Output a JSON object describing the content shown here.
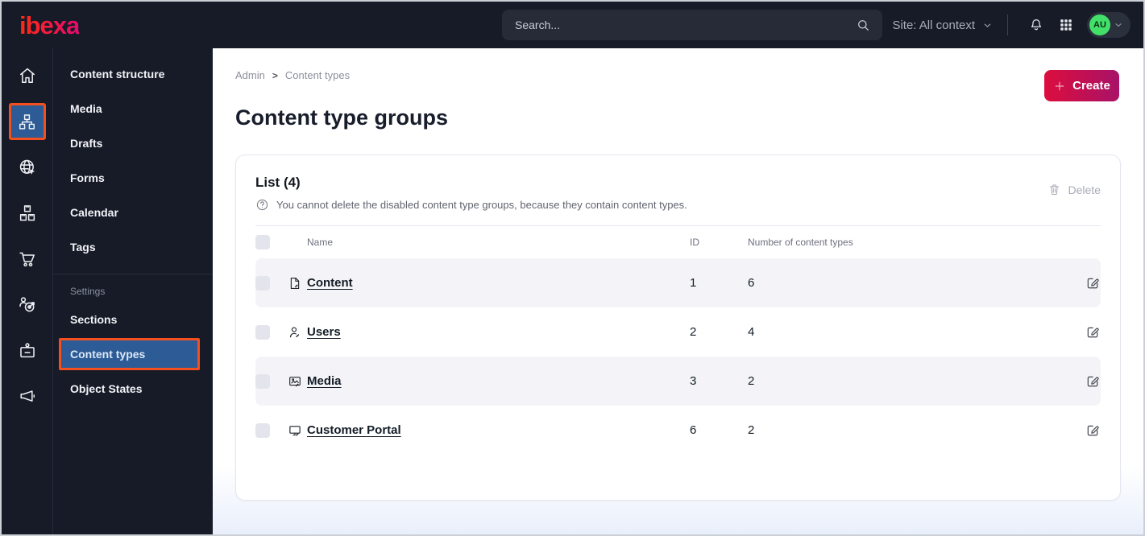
{
  "colors": {
    "topbar-bg": "#161b27",
    "accent-orange": "#f4501f",
    "active-blue": "#2c5b95",
    "create-grad-start": "#dc0e3e",
    "create-grad-end": "#a81267",
    "avatar-green": "#43e069",
    "link-dark": "#131c26"
  },
  "topbar": {
    "logo_text": "ibexa",
    "search": {
      "placeholder": "Search..."
    },
    "site_selector": {
      "label": "Site: All context"
    },
    "avatar": {
      "initials": "AU"
    }
  },
  "rail": {
    "items": [
      {
        "name": "dashboard"
      },
      {
        "name": "content",
        "active": true
      },
      {
        "name": "site"
      },
      {
        "name": "product-catalog"
      },
      {
        "name": "commerce"
      },
      {
        "name": "personalization"
      },
      {
        "name": "admin"
      },
      {
        "name": "campaign"
      }
    ]
  },
  "sidebar": {
    "items": [
      {
        "label": "Content structure"
      },
      {
        "label": "Media"
      },
      {
        "label": "Drafts"
      },
      {
        "label": "Forms"
      },
      {
        "label": "Calendar"
      },
      {
        "label": "Tags"
      }
    ],
    "settings_section": {
      "label": "Settings",
      "items": [
        {
          "label": "Sections"
        },
        {
          "label": "Content types",
          "active": true
        },
        {
          "label": "Object States"
        }
      ]
    }
  },
  "breadcrumb": {
    "items": [
      {
        "label": "Admin"
      },
      {
        "label": "Content types"
      }
    ],
    "separator": ">"
  },
  "page": {
    "title": "Content type groups"
  },
  "create_button": {
    "label": "Create"
  },
  "list_card": {
    "title": "List (4)",
    "info_text": "You cannot delete the disabled content type groups, because they contain content types.",
    "delete_button": {
      "label": "Delete"
    },
    "table": {
      "columns": {
        "name": "Name",
        "id": "ID",
        "count": "Number of content types"
      },
      "rows": [
        {
          "icon": "file",
          "name": "Content",
          "id": "1",
          "count": "6"
        },
        {
          "icon": "user",
          "name": "Users",
          "id": "2",
          "count": "4"
        },
        {
          "icon": "image",
          "name": "Media",
          "id": "3",
          "count": "2"
        },
        {
          "icon": "monitor",
          "name": "Customer Portal",
          "id": "6",
          "count": "2"
        }
      ]
    }
  }
}
